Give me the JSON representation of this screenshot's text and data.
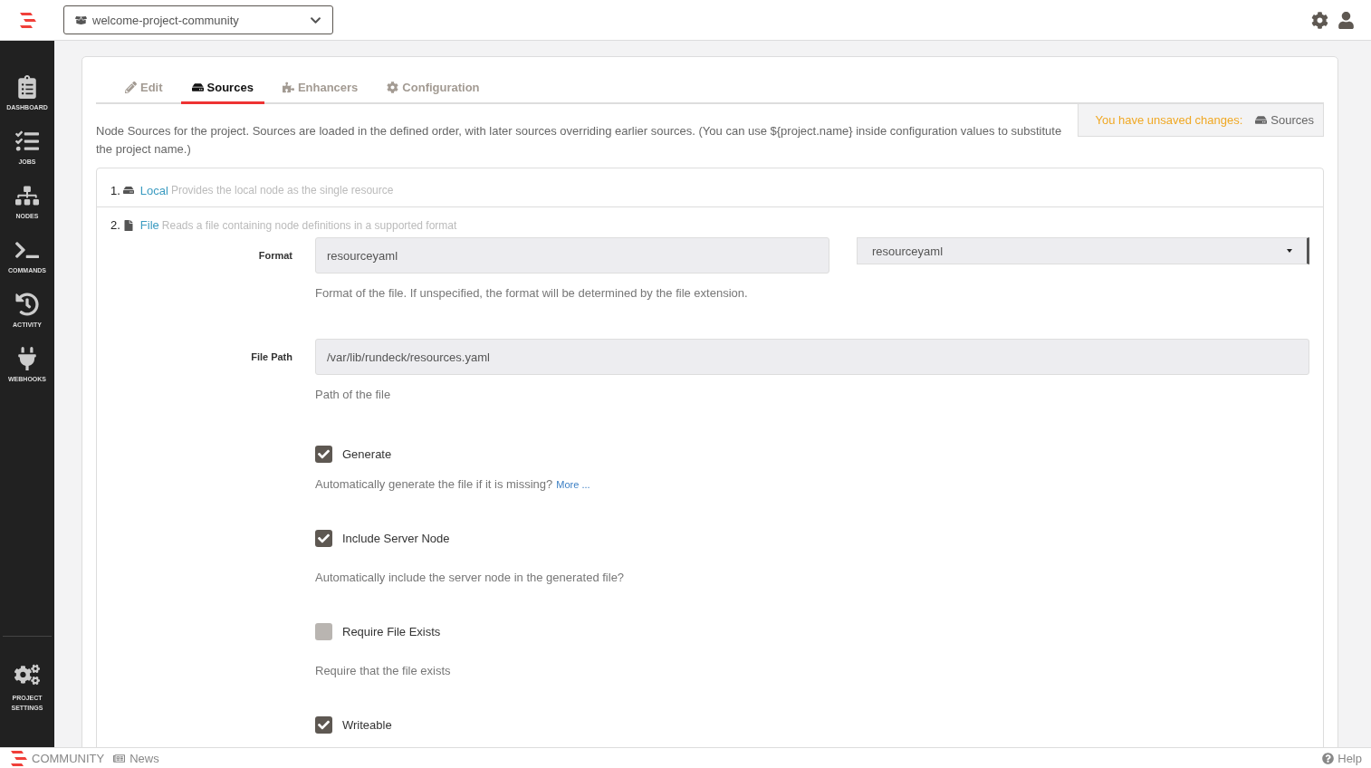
{
  "project_selector": {
    "value": "welcome-project-community"
  },
  "sidebar": {
    "items": [
      {
        "label": "DASHBOARD",
        "kind": "dashboard"
      },
      {
        "label": "JOBS",
        "kind": "jobs"
      },
      {
        "label": "NODES",
        "kind": "nodes"
      },
      {
        "label": "COMMANDS",
        "kind": "commands"
      },
      {
        "label": "ACTIVITY",
        "kind": "activity"
      },
      {
        "label": "WEBHOOKS",
        "kind": "webhooks"
      }
    ],
    "bottom_item": {
      "label": "PROJECT SETTINGS"
    }
  },
  "tabs": [
    {
      "label": "Edit",
      "kind": "edit",
      "selected": false
    },
    {
      "label": "Sources",
      "kind": "sources",
      "selected": true
    },
    {
      "label": "Enhancers",
      "kind": "enhancers",
      "selected": false
    },
    {
      "label": "Configuration",
      "kind": "configuration",
      "selected": false
    }
  ],
  "unsaved_notice": {
    "message": "You have unsaved changes:",
    "item": "Sources"
  },
  "description": "Node Sources for the project. Sources are loaded in the defined order, with later sources overriding earlier sources. (You can use ${project.name} inside configuration values to substitute the project name.)",
  "sources": [
    {
      "number": "1.",
      "kind": "local",
      "name": "Local",
      "description": "Provides the local node as the single resource"
    },
    {
      "number": "2.",
      "kind": "file",
      "name": "File",
      "description": "Reads a file containing node definitions in a supported format"
    }
  ],
  "fields": [
    {
      "kind": "format",
      "label": "Format",
      "value": "resourceyaml",
      "select_value": "resourceyaml",
      "help": "Format of the file. If unspecified, the format will be determined by the file extension."
    },
    {
      "kind": "text",
      "label": "File Path",
      "value": "/var/lib/rundeck/resources.yaml",
      "help": "Path of the file"
    },
    {
      "kind": "checkbox",
      "label": "Generate",
      "checked": true,
      "help": "Automatically generate the file if it is missing?",
      "link": "More ..."
    },
    {
      "kind": "checkbox",
      "label": "Include Server Node",
      "checked": true,
      "help": "Automatically include the server node in the generated file?"
    },
    {
      "kind": "checkbox",
      "label": "Require File Exists",
      "checked": false,
      "help": "Require that the file exists"
    },
    {
      "kind": "checkbox",
      "label": "Writeable",
      "checked": true
    }
  ],
  "footer": {
    "edition": "COMMUNITY",
    "news": "News",
    "help": "Help"
  }
}
